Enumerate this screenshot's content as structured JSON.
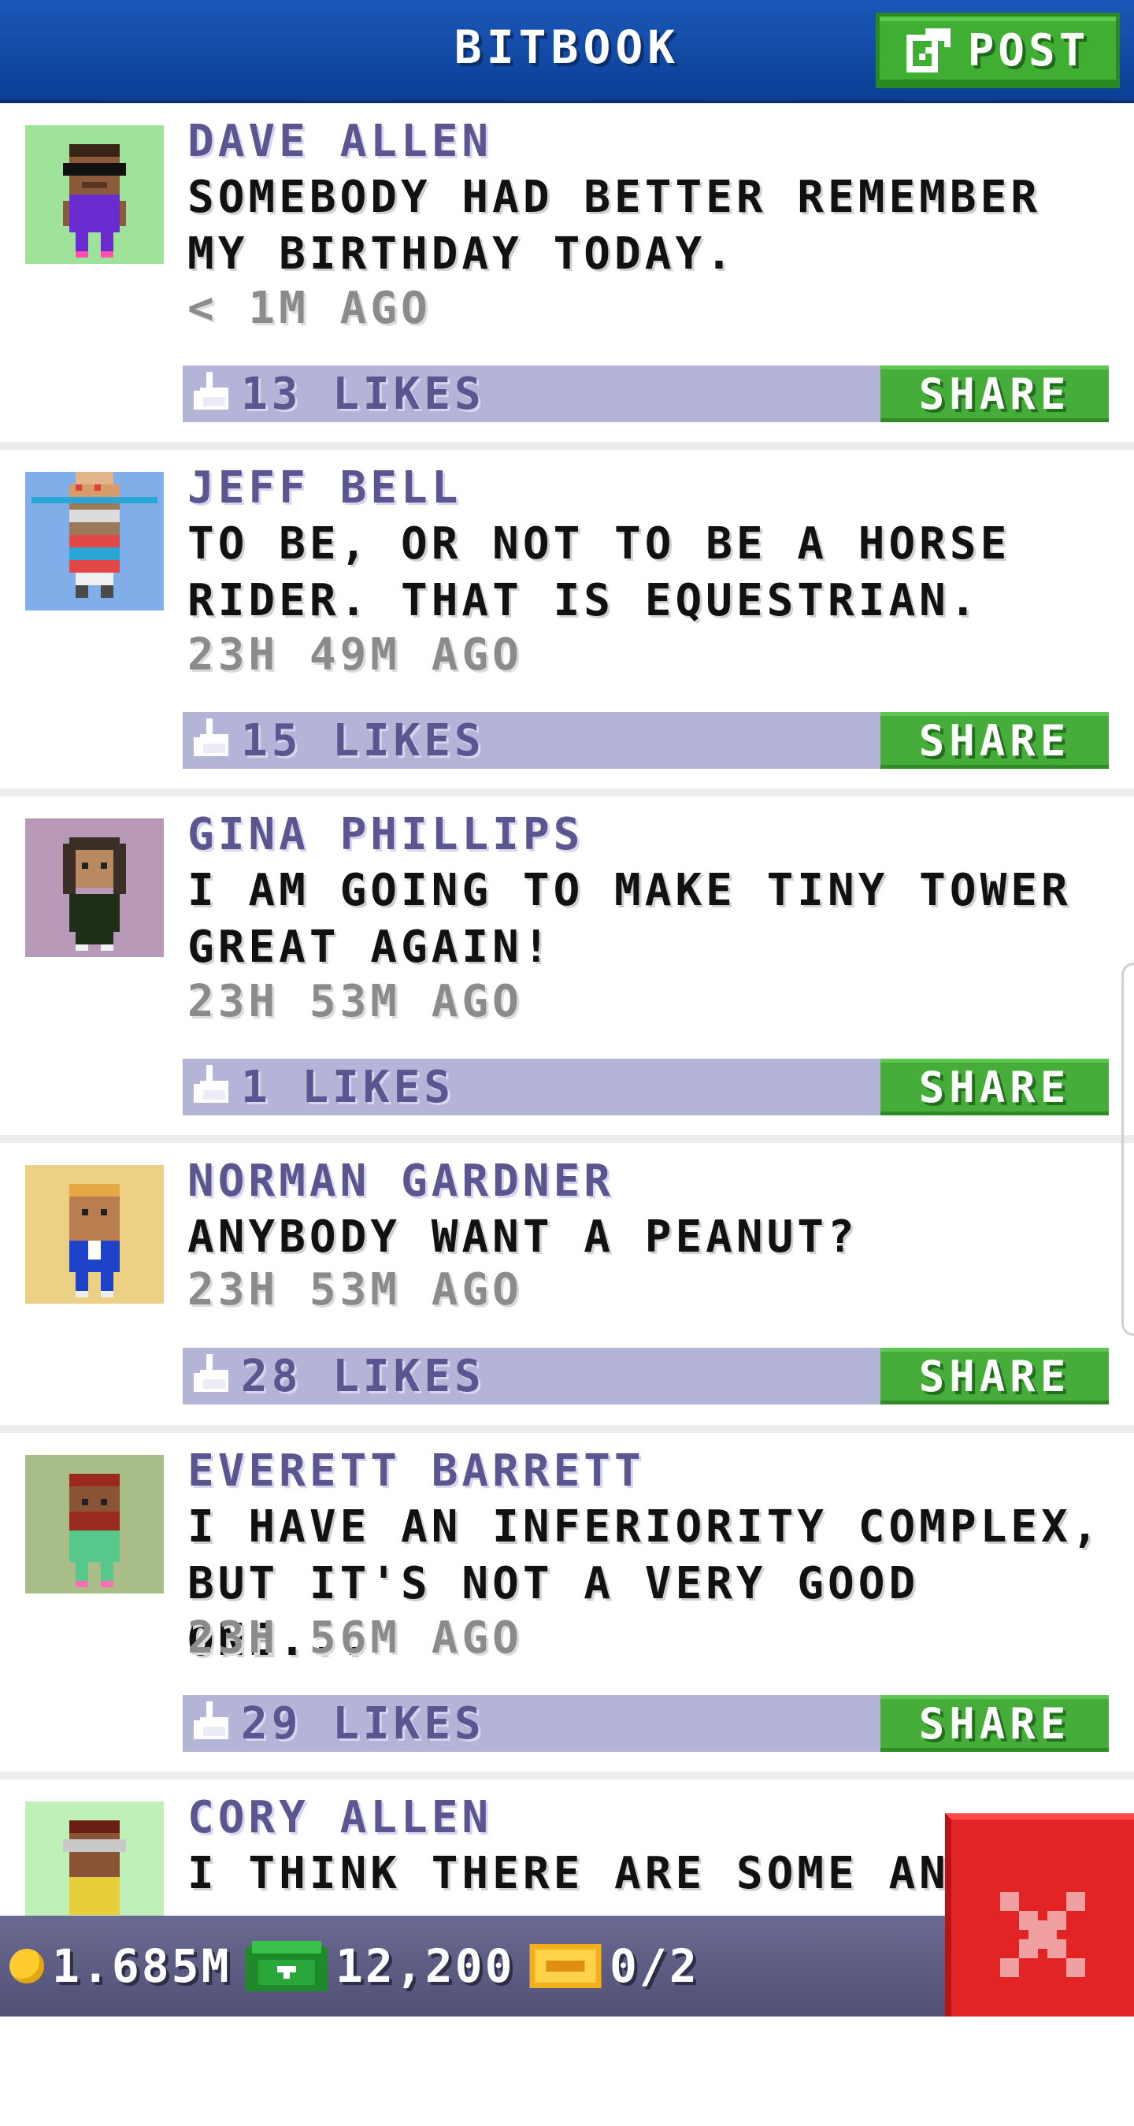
{
  "header": {
    "title": "BITBOOK",
    "post_label": "POST"
  },
  "share_label": "SHARE",
  "posts": [
    {
      "name": "DAVE ALLEN",
      "text": "SOMEBODY HAD BETTER REMEMBER MY BIRTHDAY TODAY.",
      "time": "< 1M AGO",
      "likes": "13 LIKES",
      "avatar_bg": "#9fe39b"
    },
    {
      "name": "JEFF BELL",
      "text": "TO BE, OR NOT TO BE A HORSE RIDER. THAT IS EQUESTRIAN.",
      "time": "23H 49M AGO",
      "likes": "15 LIKES",
      "avatar_bg": "#7faee8"
    },
    {
      "name": "GINA PHILLIPS",
      "text": "I AM GOING TO MAKE TINY TOWER GREAT AGAIN!",
      "time": "23H 53M AGO",
      "likes": "1 LIKES",
      "avatar_bg": "#b89ab8"
    },
    {
      "name": "NORMAN GARDNER",
      "text": "ANYBODY WANT A PEANUT?",
      "time": "23H 53M AGO",
      "likes": "28 LIKES",
      "avatar_bg": "#ecd184"
    },
    {
      "name": "EVERETT BARRETT",
      "text": "I HAVE AN INFERIORITY COMPLEX, BUT IT'S NOT A VERY GOOD ONE...",
      "time": "23H 56M AGO",
      "likes": "29 LIKES",
      "avatar_bg": "#a9bd88"
    },
    {
      "name": "CORY ALLEN",
      "text": "I THINK THERE ARE SOME ANGRY",
      "avatar_bg": "#bff0b8"
    }
  ],
  "bottom_bar": {
    "coins": "1.685M",
    "bux": "12,200",
    "tickets": "0/2"
  },
  "icons": [
    "pencil-icon",
    "thumbs-up-icon",
    "coin-icon",
    "bux-icon",
    "ticket-icon",
    "close-icon"
  ]
}
